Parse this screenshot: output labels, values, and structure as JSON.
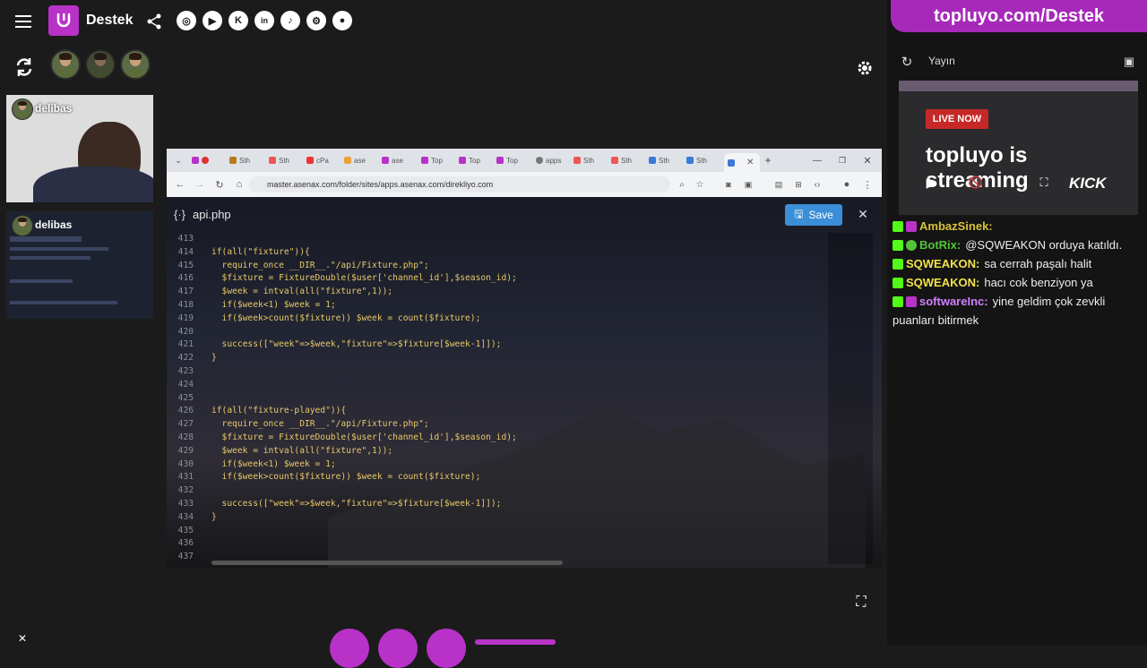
{
  "header": {
    "brand": "Destek",
    "social_icons": [
      "instagram-icon",
      "youtube-icon",
      "kick-icon",
      "linkedin-icon",
      "tiktok-icon",
      "steam-icon",
      "github-icon"
    ]
  },
  "participants": {
    "cam1_name": "delibas",
    "cam2_name": "delibas"
  },
  "browser": {
    "url": "master.asenax.com/folder/sites/apps.asenax.com/direkliyo.com",
    "tabs": [
      "Sth",
      "cPa",
      "Top",
      "Top",
      "Top",
      "apps",
      "Sth",
      "Sth",
      "Sth",
      "Sth"
    ]
  },
  "editor": {
    "filename": "api.php",
    "save_label": "Save",
    "lines": [
      {
        "n": "413",
        "c": ""
      },
      {
        "n": "414",
        "c": "if(all(\"fixture\")){"
      },
      {
        "n": "415",
        "c": "  require_once __DIR__.\"/api/Fixture.php\";"
      },
      {
        "n": "416",
        "c": "  $fixture = FixtureDouble($user['channel_id'],$season_id);"
      },
      {
        "n": "417",
        "c": "  $week = intval(all(\"fixture\",1));"
      },
      {
        "n": "418",
        "c": "  if($week<1) $week = 1;"
      },
      {
        "n": "419",
        "c": "  if($week>count($fixture)) $week = count($fixture);"
      },
      {
        "n": "420",
        "c": ""
      },
      {
        "n": "421",
        "c": "  success([\"week\"=>$week,\"fixture\"=>$fixture[$week-1]]);"
      },
      {
        "n": "422",
        "c": "}"
      },
      {
        "n": "423",
        "c": ""
      },
      {
        "n": "424",
        "c": ""
      },
      {
        "n": "425",
        "c": ""
      },
      {
        "n": "426",
        "c": "if(all(\"fixture-played\")){"
      },
      {
        "n": "427",
        "c": "  require_once __DIR__.\"/api/Fixture.php\";"
      },
      {
        "n": "428",
        "c": "  $fixture = FixtureDouble($user['channel_id'],$season_id);"
      },
      {
        "n": "429",
        "c": "  $week = intval(all(\"fixture\",1));"
      },
      {
        "n": "430",
        "c": "  if($week<1) $week = 1;"
      },
      {
        "n": "431",
        "c": "  if($week>count($fixture)) $week = count($fixture);"
      },
      {
        "n": "432",
        "c": ""
      },
      {
        "n": "433",
        "c": "  success([\"week\"=>$week,\"fixture\"=>$fixture[$week-1]]);"
      },
      {
        "n": "434",
        "c": "}"
      },
      {
        "n": "435",
        "c": ""
      },
      {
        "n": "436",
        "c": ""
      },
      {
        "n": "437",
        "c": ""
      }
    ]
  },
  "right_panel": {
    "banner": "topluyo.com/Destek",
    "stream_label": "Yayın",
    "live_badge": "LIVE NOW",
    "preview_text": "topluyo is streaming",
    "kick_label": "KICK"
  },
  "chat": [
    {
      "user": "AmbazSinek:",
      "msg": "",
      "color": "#d9c23a"
    },
    {
      "user": "BotRix:",
      "msg": "@SQWEAKON orduya katıldı.",
      "color": "#53c43a"
    },
    {
      "user": "SQWEAKON:",
      "msg": "sa cerrah paşalı halit",
      "color": "#f2e14a"
    },
    {
      "user": "SQWEAKON:",
      "msg": "hacı cok benziyon ya",
      "color": "#f2e14a"
    },
    {
      "user": "softwareInc:",
      "msg": "yine geldim çok zevkli puanları bitirmek",
      "color": "#d080ff"
    }
  ],
  "colors": {
    "accent": "#b832c8",
    "kick_green": "#53fc18",
    "save_blue": "#3b8fd8"
  }
}
